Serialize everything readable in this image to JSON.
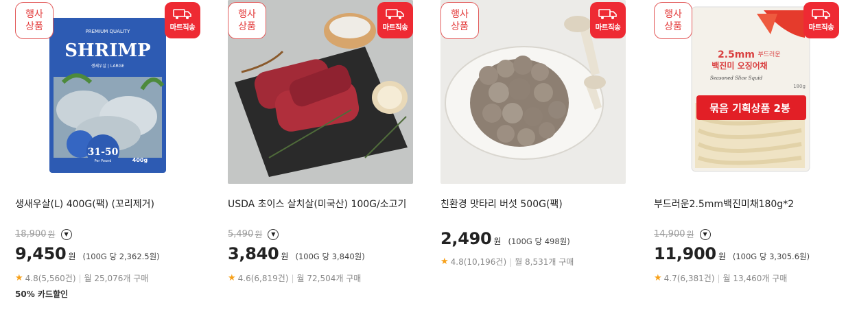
{
  "badges": {
    "event_line1": "행사",
    "event_line2": "상품",
    "direct_ship": "마트직송"
  },
  "products": [
    {
      "title": "생새우살(L) 400G(팩) (꼬리제거)",
      "original_price": "18,900",
      "currency": "원",
      "price": "9,450",
      "unit_price": "(100G 당 2,362.5원)",
      "rating": "4.8(5,560건)",
      "monthly_purchase": "월 25,076개 구매",
      "promo": "50% 카드할인",
      "image": {
        "brand_line": "PREMIUM QUALITY",
        "name": "SHRIMP",
        "subname": "생새우살 | LARGE",
        "size": "31-50",
        "size_sub": "Per Pound",
        "weight": "400g"
      }
    },
    {
      "title": "USDA 초이스 살치살(미국산) 100G/소고기",
      "original_price": "5,490",
      "currency": "원",
      "price": "3,840",
      "unit_price": "(100G 당 3,840원)",
      "rating": "4.6(6,819건)",
      "monthly_purchase": "월 72,504개 구매"
    },
    {
      "title": "친환경 맛타리 버섯 500G(팩)",
      "original_price": "",
      "currency": "원",
      "price": "2,490",
      "unit_price": "(100G 당 498원)",
      "rating": "4.8(10,196건)",
      "monthly_purchase": "월 8,531개 구매"
    },
    {
      "title": "부드러운2.5mm백진미채180g*2",
      "original_price": "14,900",
      "currency": "원",
      "price": "11,900",
      "unit_price": "(100G 당 3,305.6원)",
      "rating": "4.7(6,381건)",
      "monthly_purchase": "월 13,460개 구매",
      "image": {
        "size_text": "2.5mm",
        "label1": "부드러운",
        "label2": "백진미 오징어채",
        "sub": "Seasoned Slice Squid",
        "bundle": "묶음 기획상품 2봉",
        "weight": "180g"
      }
    }
  ]
}
